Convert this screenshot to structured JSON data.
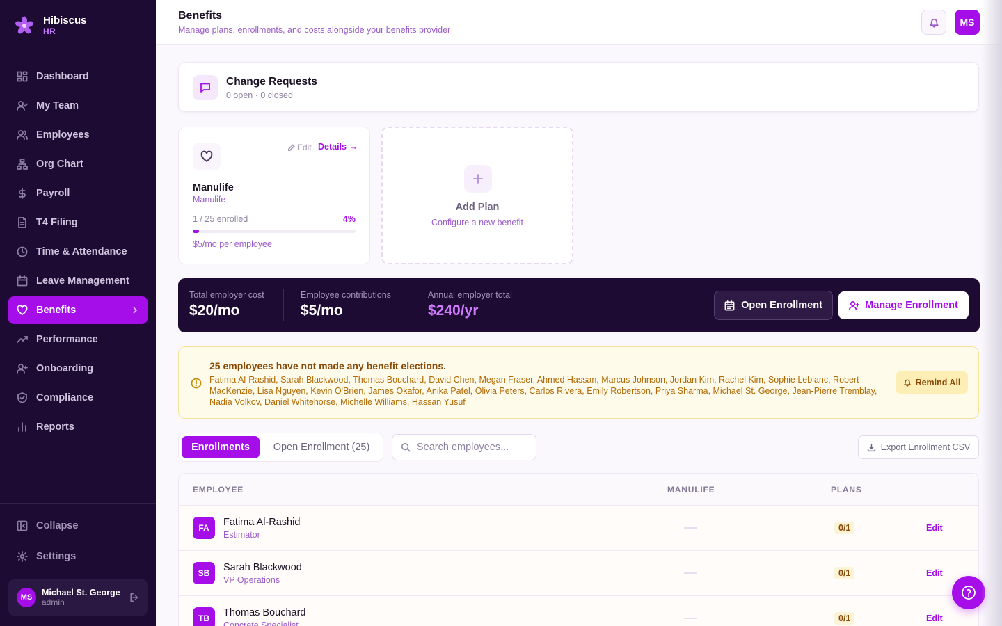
{
  "brand": {
    "name": "Hibiscus",
    "sub": "HR"
  },
  "sidebar": {
    "items": [
      {
        "label": "Dashboard"
      },
      {
        "label": "My Team"
      },
      {
        "label": "Employees"
      },
      {
        "label": "Org Chart"
      },
      {
        "label": "Payroll"
      },
      {
        "label": "T4 Filing"
      },
      {
        "label": "Time & Attendance"
      },
      {
        "label": "Leave Management"
      },
      {
        "label": "Benefits"
      },
      {
        "label": "Performance"
      },
      {
        "label": "Onboarding"
      },
      {
        "label": "Compliance"
      },
      {
        "label": "Reports"
      }
    ],
    "active": "Benefits",
    "collapse_label": "Collapse",
    "settings_label": "Settings",
    "user": {
      "initials": "MS",
      "name": "Michael St. George",
      "role": "admin"
    }
  },
  "header": {
    "title": "Benefits",
    "subtitle": "Manage plans, enrollments, and costs alongside your benefits provider",
    "avatar_initials": "MS"
  },
  "change_requests": {
    "title": "Change Requests",
    "summary": "0 open · 0 closed"
  },
  "plan": {
    "edit_label": "Edit",
    "details_label": "Details →",
    "name": "Manulife",
    "provider": "Manulife",
    "enrolled_text": "1 / 25 enrolled",
    "percent_label": "4%",
    "percent_value": 4,
    "cost_text": "$5/mo per employee"
  },
  "add_plan": {
    "title": "Add Plan",
    "subtitle": "Configure a new benefit"
  },
  "costs": {
    "employer_label": "Total employer cost",
    "employer_value": "$20/mo",
    "employee_label": "Employee contributions",
    "employee_value": "$5/mo",
    "annual_label": "Annual employer total",
    "annual_value": "$240/yr",
    "open_enrollment_label": "Open Enrollment",
    "manage_enrollment_label": "Manage Enrollment"
  },
  "alert": {
    "title": "25 employees have not made any benefit elections.",
    "names": "Fatima Al-Rashid, Sarah Blackwood, Thomas Bouchard, David Chen, Megan Fraser, Ahmed Hassan, Marcus Johnson, Jordan Kim, Rachel Kim, Sophie Leblanc, Robert MacKenzie, Lisa Nguyen, Kevin O'Brien, James Okafor, Anika Patel, Olivia Peters, Carlos Rivera, Emily Robertson, Priya Sharma, Michael St. George, Jean-Pierre Tremblay, Nadia Volkov, Daniel Whitehorse, Michelle Williams, Hassan Yusuf",
    "remind_label": "Remind All"
  },
  "tabs": {
    "enrollments": "Enrollments",
    "open_enrollment": "Open Enrollment (25)"
  },
  "search": {
    "placeholder": "Search employees..."
  },
  "export_label": "Export Enrollment CSV",
  "table": {
    "headers": {
      "employee": "EMPLOYEE",
      "plan": "MANULIFE",
      "plans": "PLANS"
    },
    "rows": [
      {
        "initials": "FA",
        "name": "Fatima Al-Rashid",
        "role": "Estimator",
        "plans": "0/1",
        "action": "Edit"
      },
      {
        "initials": "SB",
        "name": "Sarah Blackwood",
        "role": "VP Operations",
        "plans": "0/1",
        "action": "Edit"
      },
      {
        "initials": "TB",
        "name": "Thomas Bouchard",
        "role": "Concrete Specialist",
        "plans": "0/1",
        "action": "Edit"
      }
    ]
  },
  "colors": {
    "accent": "#a50ee8",
    "sidebar_bg": "#1e0b33",
    "warning_bg": "#fffbea"
  }
}
